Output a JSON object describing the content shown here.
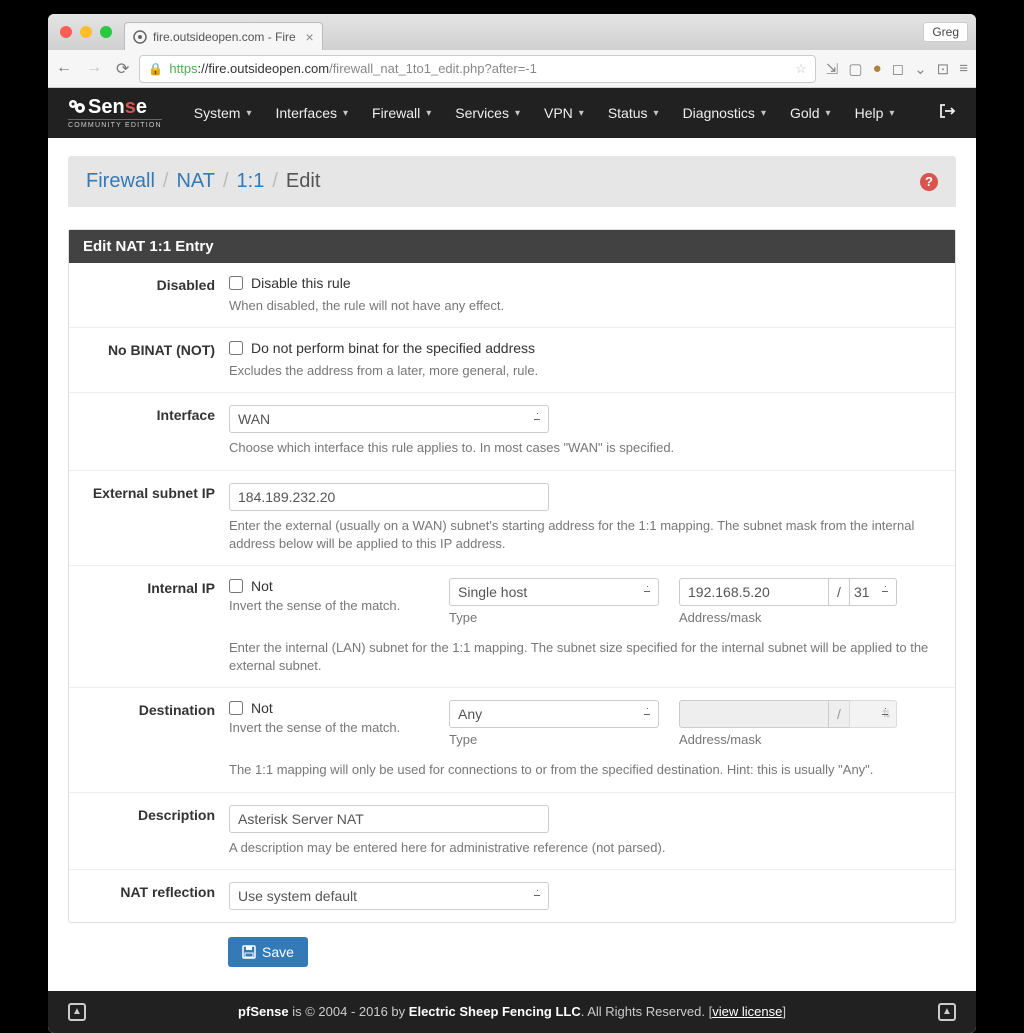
{
  "browser": {
    "tab_title": "fire.outsideopen.com - Fire",
    "user": "Greg",
    "url_proto": "https",
    "url_host": "://fire.outsideopen.com",
    "url_path": "/firewall_nat_1to1_edit.php?after=-1"
  },
  "nav": {
    "logo_main_pre": "Sen",
    "logo_main_s": "s",
    "logo_main_post": "e",
    "logo_sub": "COMMUNITY EDITION",
    "items": [
      "System",
      "Interfaces",
      "Firewall",
      "Services",
      "VPN",
      "Status",
      "Diagnostics",
      "Gold",
      "Help"
    ]
  },
  "breadcrumb": {
    "parts": [
      "Firewall",
      "NAT",
      "1:1",
      "Edit"
    ]
  },
  "panel": {
    "title": "Edit NAT 1:1 Entry"
  },
  "fields": {
    "disabled": {
      "label": "Disabled",
      "checkbox": "Disable this rule",
      "help": "When disabled, the rule will not have any effect."
    },
    "nobinat": {
      "label": "No BINAT (NOT)",
      "checkbox": "Do not perform binat for the specified address",
      "help": "Excludes the address from a later, more general, rule."
    },
    "interface": {
      "label": "Interface",
      "value": "WAN",
      "help": "Choose which interface this rule applies to. In most cases \"WAN\" is specified."
    },
    "external": {
      "label": "External subnet IP",
      "value": "184.189.232.20",
      "help": "Enter the external (usually on a WAN) subnet's starting address for the 1:1 mapping. The subnet mask from the internal address below will be applied to this IP address."
    },
    "internal": {
      "label": "Internal IP",
      "not_label": "Not",
      "not_help": "Invert the sense of the match.",
      "type_label": "Type",
      "type_value": "Single host",
      "addr_label": "Address/mask",
      "addr_value": "192.168.5.20",
      "mask_value": "31",
      "help": "Enter the internal (LAN) subnet for the 1:1 mapping. The subnet size specified for the internal subnet will be applied to the external subnet."
    },
    "destination": {
      "label": "Destination",
      "not_label": "Not",
      "not_help": "Invert the sense of the match.",
      "type_label": "Type",
      "type_value": "Any",
      "addr_label": "Address/mask",
      "addr_value": "",
      "mask_value": "",
      "help": "The 1:1 mapping will only be used for connections to or from the specified destination. Hint: this is usually \"Any\"."
    },
    "description": {
      "label": "Description",
      "value": "Asterisk Server NAT",
      "help": "A description may be entered here for administrative reference (not parsed)."
    },
    "natreflection": {
      "label": "NAT reflection",
      "value": "Use system default"
    }
  },
  "buttons": {
    "save": "Save"
  },
  "footer": {
    "brand": "pfSense",
    "mid1": " is © 2004 - 2016 by ",
    "company": "Electric Sheep Fencing LLC",
    "mid2": ". All Rights Reserved. [",
    "link": "view license",
    "mid3": "]"
  }
}
